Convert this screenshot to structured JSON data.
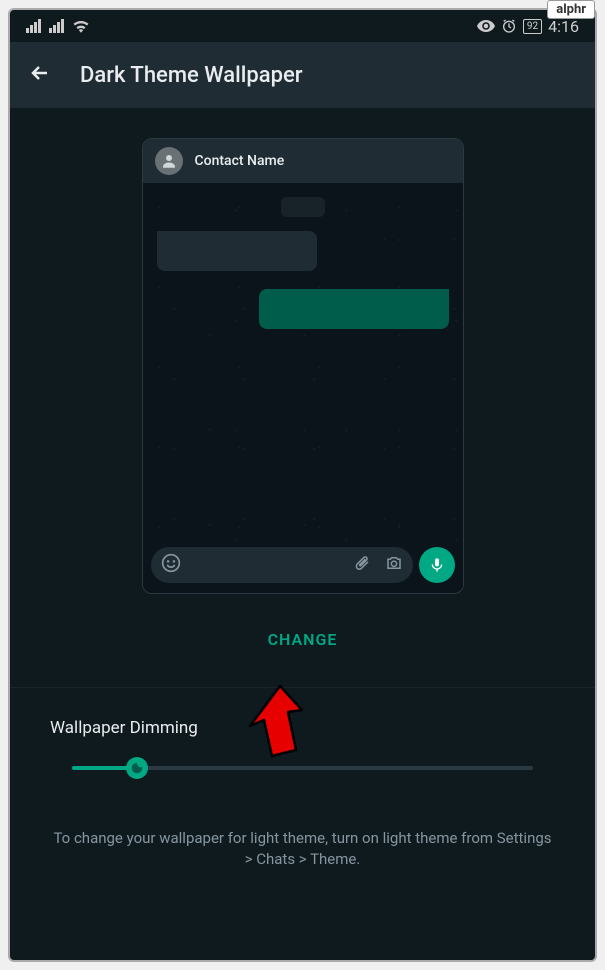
{
  "watermark": "alphr",
  "status_bar": {
    "battery": "92",
    "time": "4:16"
  },
  "header": {
    "title": "Dark Theme Wallpaper"
  },
  "preview": {
    "contact_name": "Contact Name"
  },
  "change_button": "CHANGE",
  "dimming": {
    "label": "Wallpaper Dimming",
    "value_percent": 14
  },
  "footer_hint": "To change your wallpaper for light theme, turn on light theme from Settings > Chats > Theme."
}
